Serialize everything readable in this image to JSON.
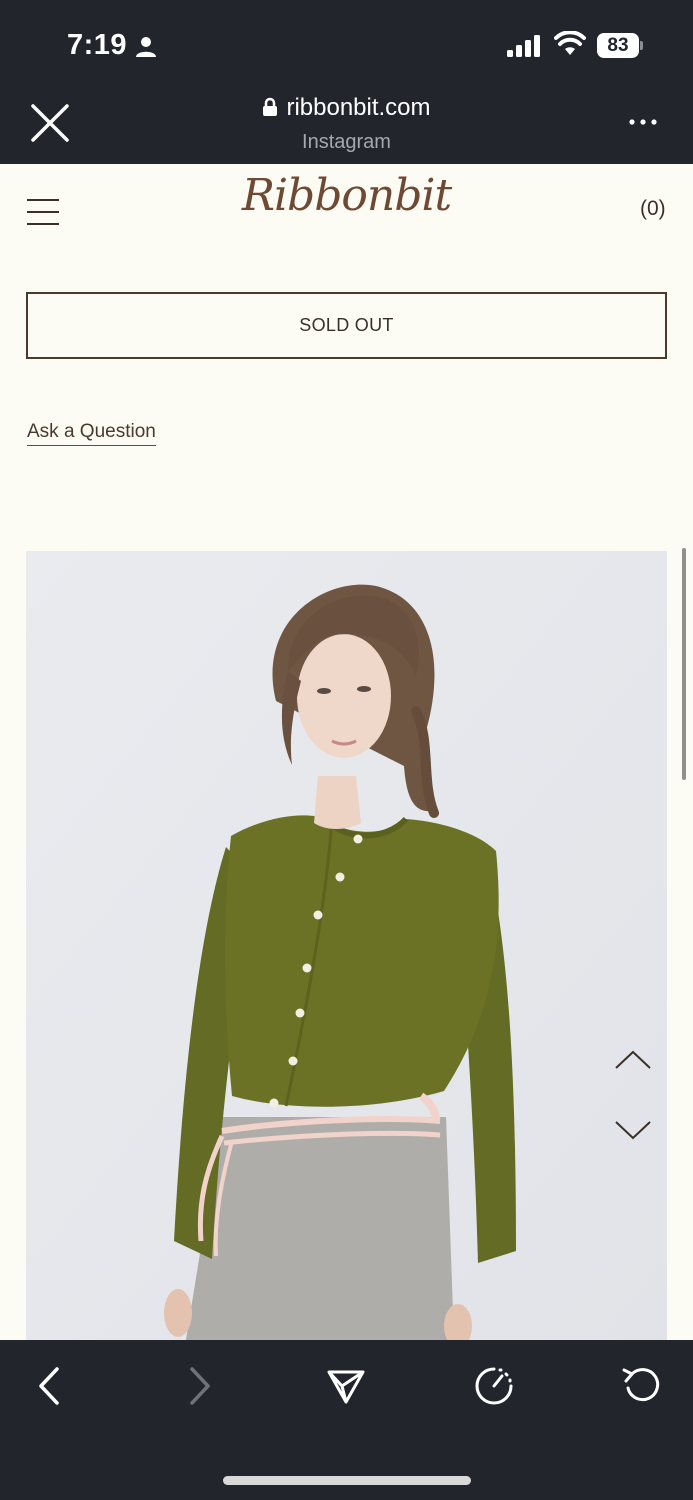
{
  "status_bar": {
    "time": "7:19",
    "battery": "83",
    "battery_level_percent": 83
  },
  "browser": {
    "url": "ribbonbit.com",
    "source": "Instagram",
    "close_icon": "close-icon",
    "more_icon": "more-icon"
  },
  "header": {
    "menu_icon": "hamburger-icon",
    "logo": "Ribbonbit",
    "cart_count": "(0)"
  },
  "product": {
    "sold_out_label": "SOLD OUT",
    "ask_question_label": "Ask a Question",
    "image_description_icon": "product-photo-green-cardigan",
    "gallery_up_icon": "chevron-up-icon",
    "gallery_down_icon": "chevron-down-icon"
  },
  "toolbar": {
    "items": [
      "back-icon",
      "forward-icon",
      "share-icon",
      "speed-icon",
      "reload-icon"
    ]
  },
  "colors": {
    "chrome_bg": "#22262c",
    "page_bg": "#fdfcf4",
    "brand_brown": "#6e4a35",
    "cardigan_green": "#6b7226"
  }
}
